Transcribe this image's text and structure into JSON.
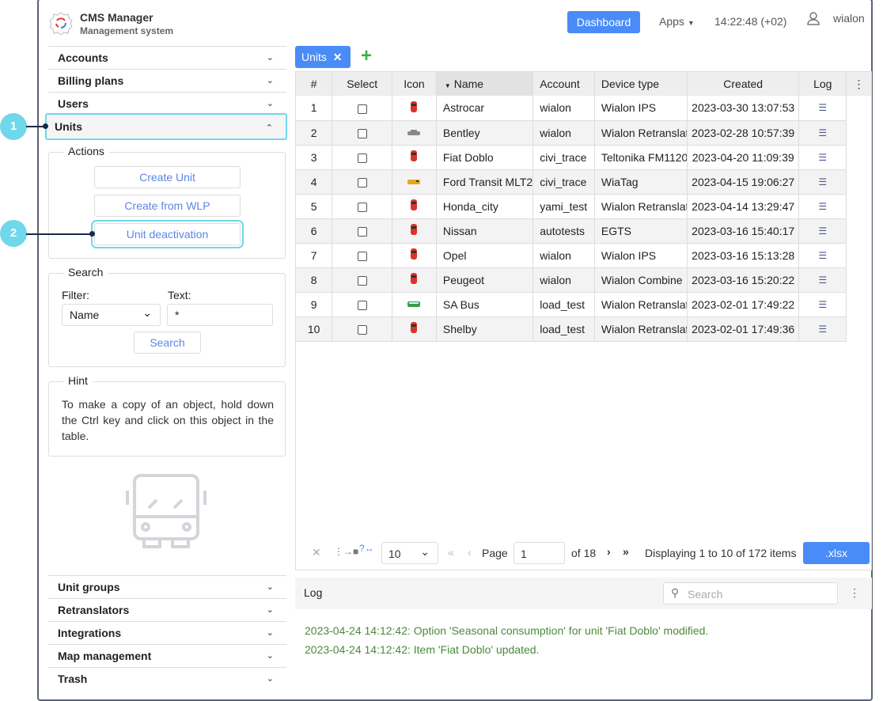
{
  "header": {
    "title": "CMS Manager",
    "subtitle": "Management system",
    "dashboard": "Dashboard",
    "apps": "Apps",
    "time": "14:22:48 (+02)",
    "user": "wialon"
  },
  "sidebar": {
    "top": [
      "Accounts",
      "Billing plans",
      "Users",
      "Units"
    ],
    "bottom": [
      "Unit groups",
      "Retranslators",
      "Integrations",
      "Map management",
      "Trash"
    ],
    "actions": {
      "title": "Actions",
      "buttons": [
        "Create Unit",
        "Create from WLP",
        "Unit deactivation"
      ]
    },
    "search": {
      "title": "Search",
      "filter_label": "Filter:",
      "filter_value": "Name",
      "text_label": "Text:",
      "text_value": "*",
      "button": "Search"
    },
    "hint": {
      "title": "Hint",
      "text": "To make a copy of an object, hold down the Ctrl key and click on this object in the table."
    }
  },
  "callouts": [
    "1",
    "2"
  ],
  "tab": {
    "label": "Units"
  },
  "table": {
    "columns": [
      "#",
      "Select",
      "Icon",
      "Name",
      "Account",
      "Device type",
      "Created",
      "Log"
    ],
    "rows": [
      [
        "1",
        "red-car",
        "Astrocar",
        "wialon",
        "Wialon IPS",
        "2023-03-30 13:07:53"
      ],
      [
        "2",
        "grey-car",
        "Bentley",
        "wialon",
        "Wialon Retranslator",
        "2023-02-28 10:57:39"
      ],
      [
        "3",
        "red-car",
        "Fiat Doblo",
        "civi_trace",
        "Teltonika FM1120",
        "2023-04-20 11:09:39"
      ],
      [
        "4",
        "yellow-van",
        "Ford Transit MLT2",
        "civi_trace",
        "WiaTag",
        "2023-04-15 19:06:27"
      ],
      [
        "5",
        "red-car",
        "Honda_city",
        "yami_test",
        "Wialon Retranslator",
        "2023-04-14 13:29:47"
      ],
      [
        "6",
        "red-car",
        "Nissan",
        "autotests",
        "EGTS",
        "2023-03-16 15:40:17"
      ],
      [
        "7",
        "red-car",
        "Opel",
        "wialon",
        "Wialon IPS",
        "2023-03-16 15:13:28"
      ],
      [
        "8",
        "red-car",
        "Peugeot",
        "wialon",
        "Wialon Combine",
        "2023-03-16 15:20:22"
      ],
      [
        "9",
        "green-bus",
        "SA Bus",
        "load_test",
        "Wialon Retranslator",
        "2023-02-01 17:49:22"
      ],
      [
        "10",
        "red-car",
        "Shelby",
        "load_test",
        "Wialon Retranslator",
        "2023-02-01 17:49:36"
      ]
    ]
  },
  "pager": {
    "per_page": "10",
    "page_label": "Page",
    "page": "1",
    "of": "of 18",
    "display": "Displaying 1 to 10 of 172 items",
    "export": ".xlsx"
  },
  "log": {
    "title": "Log",
    "search_placeholder": "Search",
    "messages": [
      "2023-04-24 14:12:42: Option 'Seasonal consumption' for unit 'Fiat Doblo' modified.",
      "2023-04-24 14:12:42: Item 'Fiat Doblo' updated."
    ]
  }
}
